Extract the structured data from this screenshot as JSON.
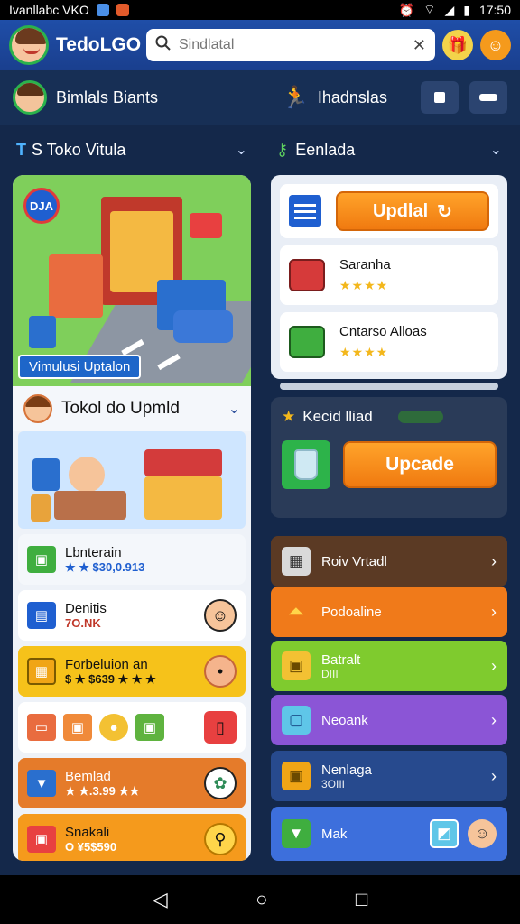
{
  "status_bar": {
    "carrier": "Ivanllabc VKO",
    "time": "17:50"
  },
  "app_bar": {
    "title": "TedoLGO",
    "search_placeholder": "Sindlatal"
  },
  "user_bar": {
    "name": "Bimlals Biants",
    "status_label": "Ihadnslas"
  },
  "left_section": {
    "title": "S Toko Vitula",
    "hero_sign": "DJA",
    "hero_banner": "Vimulusi Uptalon",
    "card_title": "Tokol do Upmld",
    "items": [
      {
        "title": "Lbnterain",
        "subtitle": "★ ★ $30,0.913"
      },
      {
        "title": "Denitis",
        "subtitle": "7O.NK"
      },
      {
        "title": "Forbeluion an",
        "subtitle": "$ ★ $639 ★ ★ ★"
      },
      {
        "title": "",
        "subtitle": ""
      },
      {
        "title": "Bemlad",
        "subtitle": "★ ★.3.99 ★★"
      },
      {
        "title": "Snakali",
        "subtitle": "O ¥5$590"
      }
    ]
  },
  "right_section": {
    "title": "Eenlada",
    "update_button": "Updlal",
    "items": [
      {
        "title": "Saranha",
        "stars": "★★★★"
      },
      {
        "title": "Cntarso Alloas",
        "stars": "★★★★"
      }
    ],
    "promo": {
      "title": "Kecid lliad",
      "button": "Upcade"
    },
    "menu": [
      {
        "label": "Roiv Vrtadl",
        "sub": "",
        "color": "#5b3a24"
      },
      {
        "label": "Podoaline",
        "sub": "",
        "color": "#f07a1a"
      },
      {
        "label": "Batralt",
        "sub": "DIII",
        "color": "#7fcb2e"
      },
      {
        "label": "Neoank",
        "sub": "",
        "color": "#8b55d6"
      },
      {
        "label": "Nenlaga",
        "sub": "3OIII",
        "color": "#274a8e"
      },
      {
        "label": "Mak",
        "sub": "",
        "color": "#3d6fdc"
      }
    ]
  },
  "nav": {
    "back": "◁",
    "home": "○",
    "recents": "□"
  }
}
